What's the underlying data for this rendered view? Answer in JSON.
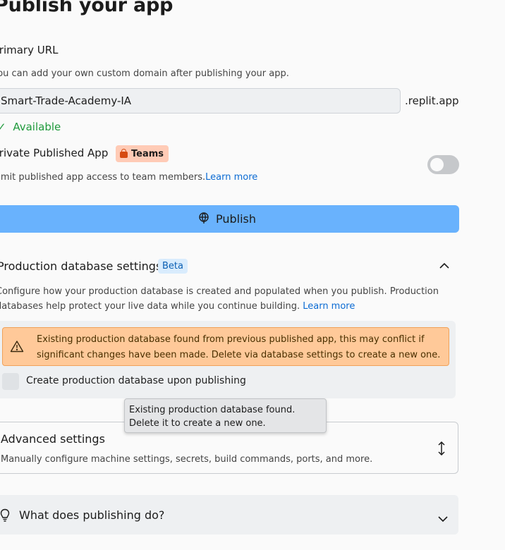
{
  "page": {
    "title": "Publish your app"
  },
  "primary_url": {
    "label": "Primary URL",
    "description": "You can add your own custom domain after publishing your app.",
    "value": "Smart-Trade-Academy-IA",
    "suffix": ".replit.app",
    "status": "Available"
  },
  "private_app": {
    "label": "Private Published App",
    "badge": "Teams",
    "description": "Limit published app access to team members.",
    "learn_more": "Learn more",
    "enabled": false
  },
  "publish_button": {
    "label": "Publish"
  },
  "prod_db": {
    "title": "Production database settings",
    "badge": "Beta",
    "description_line1": "Configure how your production database is created and populated when you publish. Production",
    "description_line2": "databases help protect your live data while you continue building.",
    "learn_more": "Learn more",
    "warning_line1": "Existing production database found from previous published app, this may conflict if",
    "warning_line2": "significant changes have been made. Delete via database settings to create a new one.",
    "checkbox_label": "Create production database upon publishing",
    "tooltip_line1": "Existing production database found.",
    "tooltip_line2": "Delete it to create a new one."
  },
  "advanced": {
    "title": "Advanced settings",
    "description": "Manually configure machine settings, secrets, build commands, ports, and more."
  },
  "faq": {
    "title": "What does publishing do?"
  }
}
